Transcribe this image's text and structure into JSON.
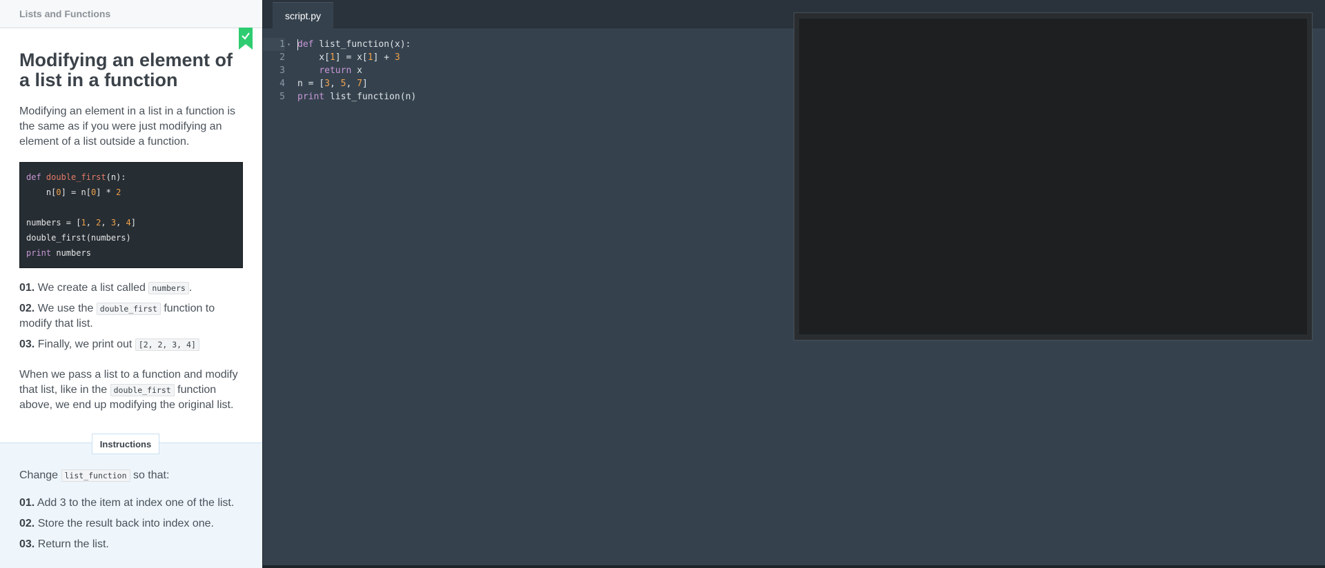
{
  "lesson": {
    "header": "Lists and Functions",
    "title": "Modifying an element of a list in a function",
    "intro": "Modifying an element in a list in a function is the same as if you were just modifying an element of a list outside a function.",
    "example_code": {
      "line1": {
        "kw": "def",
        "fn": "double_first",
        "rest": "(n):"
      },
      "line2": {
        "a": "    n[",
        "n1": "0",
        "b": "] = n[",
        "n2": "0",
        "c": "] * ",
        "n3": "2"
      },
      "line3": {
        "a": "numbers = [",
        "n1": "1",
        "c1": ", ",
        "n2": "2",
        "c2": ", ",
        "n3": "3",
        "c3": ", ",
        "n4": "4",
        "end": "]"
      },
      "line4": "double_first(numbers)",
      "line5": {
        "kw": "print",
        "rest": " numbers"
      }
    },
    "steps": [
      {
        "num": "01.",
        "before": " We create a list called ",
        "code": "numbers",
        "after": "."
      },
      {
        "num": "02.",
        "before": " We use the ",
        "code": "double_first",
        "after": " function to modify that list."
      },
      {
        "num": "03.",
        "before": " Finally, we print out ",
        "code": "[2, 2, 3, 4]",
        "after": ""
      }
    ],
    "closing": {
      "before": "When we pass a list to a function and modify that list, like in the ",
      "code": "double_first",
      "after": " function above, we end up modifying the original list."
    },
    "completed_icon": "bookmark-check-icon"
  },
  "instructions": {
    "tab_label": "Instructions",
    "lead_before": "Change ",
    "lead_code": "list_function",
    "lead_after": " so that:",
    "items": [
      {
        "num": "01.",
        "text": " Add 3 to the item at index one of the list."
      },
      {
        "num": "02.",
        "text": " Store the result back into index one."
      },
      {
        "num": "03.",
        "text": " Return the list."
      }
    ]
  },
  "editor": {
    "tab": "script.py",
    "lines": [
      {
        "no": "1",
        "parts": {
          "kw": "def",
          "rest": " list_function(x):"
        }
      },
      {
        "no": "2",
        "parts": {
          "a": "    x[",
          "n1": "1",
          "b": "] = x[",
          "n2": "1",
          "c": "] + ",
          "n3": "3"
        }
      },
      {
        "no": "3",
        "parts": {
          "a": "    ",
          "kw": "return",
          "rest": " x"
        }
      },
      {
        "no": "4",
        "parts": {
          "a": "n = [",
          "n1": "3",
          "c1": ", ",
          "n2": "5",
          "c2": ", ",
          "n3": "7",
          "end": "]"
        }
      },
      {
        "no": "5",
        "parts": {
          "kw": "print",
          "rest": " list_function(n)"
        }
      }
    ]
  },
  "colors": {
    "editor_bg": "#35424e",
    "keyword": "#c897d6",
    "number": "#f0a14a",
    "function_name": "#e47b66",
    "completed_green": "#2ecc71"
  }
}
